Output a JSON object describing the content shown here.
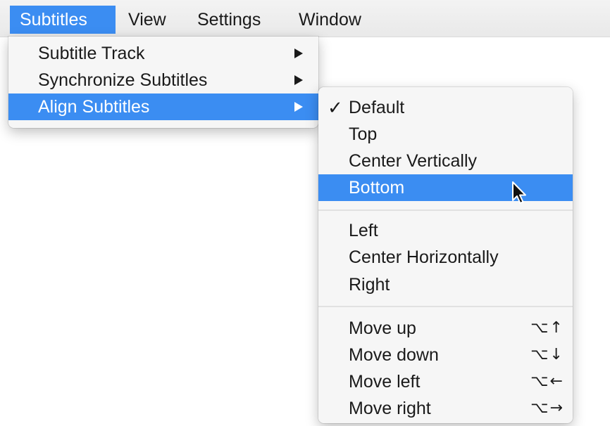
{
  "menubar": {
    "items": [
      {
        "label": "Subtitles",
        "active": true
      },
      {
        "label": "View"
      },
      {
        "label": "Settings"
      },
      {
        "label": "Window"
      }
    ]
  },
  "subtitles_menu": {
    "items": [
      {
        "label": "Subtitle Track",
        "has_submenu": true
      },
      {
        "label": "Synchronize Subtitles",
        "has_submenu": true
      },
      {
        "label": "Align Subtitles",
        "has_submenu": true,
        "highlighted": true
      }
    ]
  },
  "align_submenu": {
    "check_mark": "✓",
    "vertical": [
      {
        "label": "Default",
        "checked": true
      },
      {
        "label": "Top"
      },
      {
        "label": "Center Vertically"
      },
      {
        "label": "Bottom",
        "highlighted": true
      }
    ],
    "horizontal": [
      {
        "label": "Left"
      },
      {
        "label": "Center Horizontally"
      },
      {
        "label": "Right"
      }
    ],
    "move": [
      {
        "label": "Move up",
        "shortcut": "⌥↑"
      },
      {
        "label": "Move down",
        "shortcut": "⌥↓"
      },
      {
        "label": "Move left",
        "shortcut": "⌥←"
      },
      {
        "label": "Move right",
        "shortcut": "⌥→"
      }
    ]
  },
  "colors": {
    "highlight": "#3b8df2",
    "menu_background": "#f6f6f6",
    "text": "#1a1a1a"
  },
  "icons": {
    "submenu_arrow": "chevron-right-icon",
    "cursor": "mouse-pointer-icon"
  }
}
